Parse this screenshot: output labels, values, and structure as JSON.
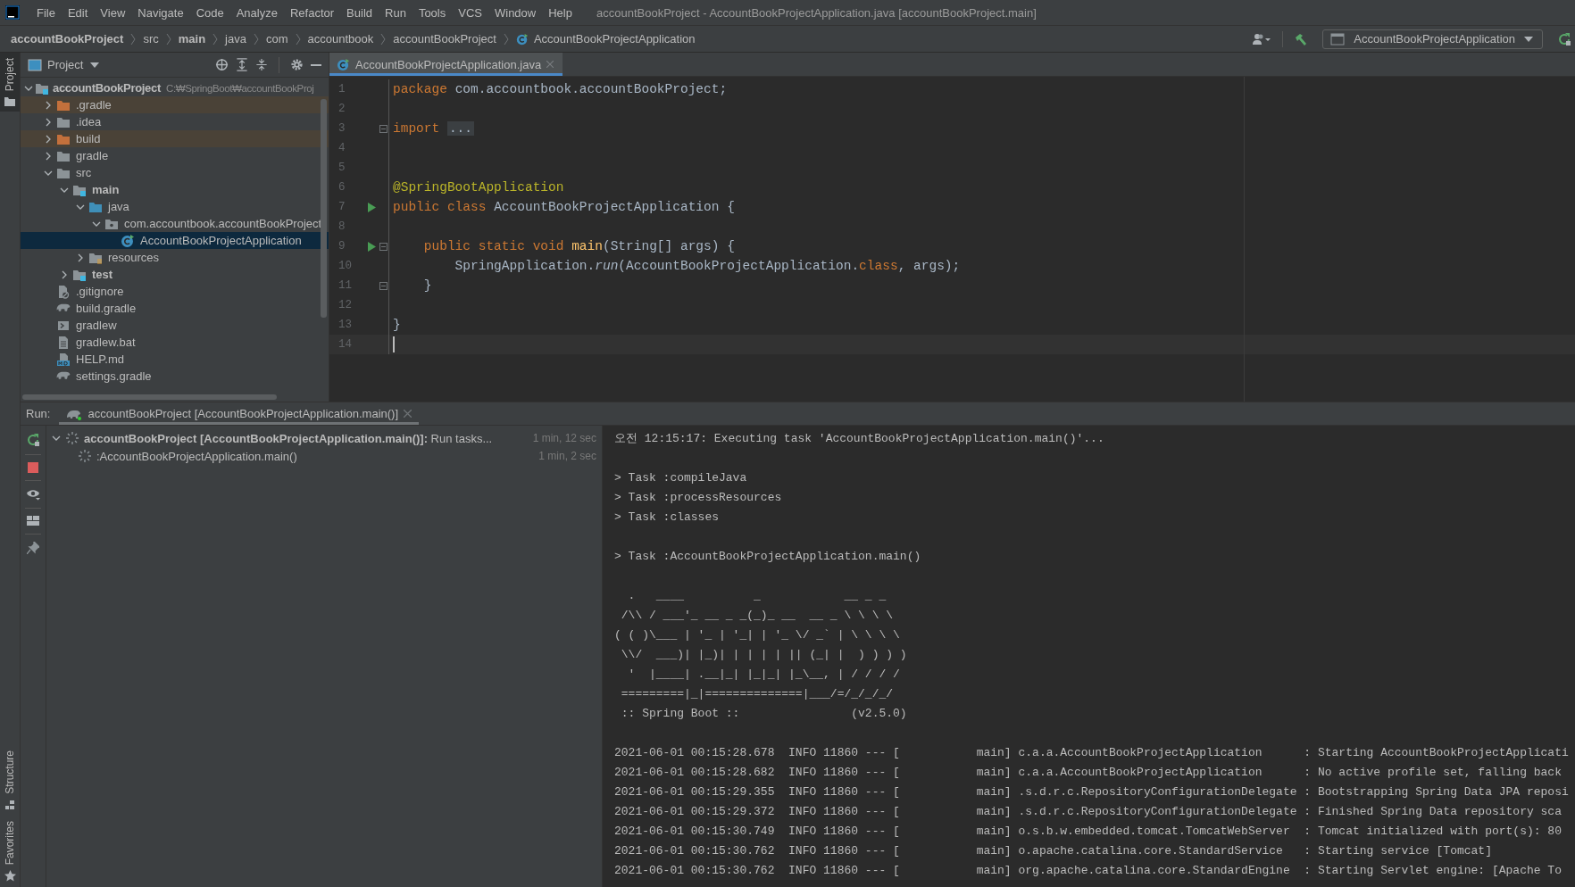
{
  "window": {
    "title": "accountBookProject - AccountBookProjectApplication.java [accountBookProject.main]"
  },
  "menu": [
    "File",
    "Edit",
    "View",
    "Navigate",
    "Code",
    "Analyze",
    "Refactor",
    "Build",
    "Run",
    "Tools",
    "VCS",
    "Window",
    "Help"
  ],
  "breadcrumbs": [
    {
      "label": "accountBookProject",
      "kind": "module"
    },
    {
      "label": "src",
      "kind": "folder"
    },
    {
      "label": "main",
      "kind": "module"
    },
    {
      "label": "java",
      "kind": "folder"
    },
    {
      "label": "com",
      "kind": "folder"
    },
    {
      "label": "accountbook",
      "kind": "folder"
    },
    {
      "label": "accountBookProject",
      "kind": "folder"
    },
    {
      "label": "AccountBookProjectApplication",
      "kind": "class"
    }
  ],
  "run_configuration": {
    "label": "AccountBookProjectApplication"
  },
  "tool_strip": {
    "top": [
      {
        "label": "Project",
        "selected": true
      }
    ],
    "bottom": [
      {
        "label": "Structure",
        "kind": "structure",
        "selected": false
      },
      {
        "label": "Favorites",
        "kind": "favorites",
        "selected": false
      }
    ]
  },
  "project_panel": {
    "title": "Project"
  },
  "project_tree": {
    "items": [
      {
        "label": "accountBookProject",
        "hint": "C:₩SpringBoot₩accountBookProj",
        "kind": "module",
        "expanded": true,
        "selected": false,
        "children": [
          {
            "label": ".gradle",
            "kind": "excluded-folder",
            "expanded": false,
            "selected": false
          },
          {
            "label": ".idea",
            "kind": "folder",
            "expanded": false,
            "selected": false
          },
          {
            "label": "build",
            "kind": "excluded-folder",
            "expanded": false,
            "selected": false
          },
          {
            "label": "gradle",
            "kind": "folder",
            "expanded": false,
            "selected": false
          },
          {
            "label": "src",
            "kind": "folder",
            "expanded": true,
            "selected": false,
            "children": [
              {
                "label": "main",
                "kind": "module",
                "expanded": true,
                "selected": false,
                "children": [
                  {
                    "label": "java",
                    "kind": "source-folder",
                    "expanded": true,
                    "selected": false,
                    "children": [
                      {
                        "label": "com.accountbook.accountBookProject",
                        "kind": "package",
                        "expanded": true,
                        "selected": false,
                        "children": [
                          {
                            "label": "AccountBookProjectApplication",
                            "kind": "class",
                            "selected": true
                          }
                        ]
                      }
                    ]
                  },
                  {
                    "label": "resources",
                    "kind": "resource-folder",
                    "expanded": false,
                    "selected": false
                  }
                ]
              },
              {
                "label": "test",
                "kind": "module",
                "expanded": false,
                "selected": false
              }
            ]
          },
          {
            "label": ".gitignore",
            "kind": "ignore-file",
            "selected": false
          },
          {
            "label": "build.gradle",
            "kind": "gradle-file",
            "selected": false
          },
          {
            "label": "gradlew",
            "kind": "script",
            "selected": false
          },
          {
            "label": "gradlew.bat",
            "kind": "text-file",
            "selected": false
          },
          {
            "label": "HELP.md",
            "kind": "markdown",
            "selected": false
          },
          {
            "label": "settings.gradle",
            "kind": "gradle-file",
            "selected": false
          }
        ]
      }
    ]
  },
  "editor_tabs": [
    {
      "label": "AccountBookProjectApplication.java",
      "selected": true
    }
  ],
  "code": [
    {
      "number": "1",
      "tokens": [
        {
          "text": "package ",
          "kind": "keyword"
        },
        {
          "text": "com.accountbook.accountBookProject;",
          "kind": "plain"
        }
      ]
    },
    {
      "number": "2"
    },
    {
      "number": "3",
      "fold_marker": true,
      "tokens": [
        {
          "text": "import ",
          "kind": "keyword"
        },
        {
          "text": "...",
          "kind": "folded"
        }
      ]
    },
    {
      "number": "4"
    },
    {
      "number": "5"
    },
    {
      "number": "6",
      "tokens": [
        {
          "text": "@SpringBootApplication",
          "kind": "annotation"
        }
      ]
    },
    {
      "number": "7",
      "run_marker": true,
      "tokens": [
        {
          "text": "public class ",
          "kind": "keyword"
        },
        {
          "text": "AccountBookProjectApplication {",
          "kind": "plain"
        }
      ]
    },
    {
      "number": "8"
    },
    {
      "number": "9",
      "run_marker": true,
      "fold_marker": true,
      "tokens": [
        {
          "text": "    public static void ",
          "kind": "keyword"
        },
        {
          "text": "main",
          "kind": "method"
        },
        {
          "text": "(String[] args) {",
          "kind": "plain"
        }
      ]
    },
    {
      "number": "10",
      "tokens": [
        {
          "text": "        SpringApplication.",
          "kind": "plain"
        },
        {
          "text": "run",
          "kind": "static-call"
        },
        {
          "text": "(AccountBookProjectApplication.",
          "kind": "plain"
        },
        {
          "text": "class",
          "kind": "keyword"
        },
        {
          "text": ", args);",
          "kind": "plain"
        }
      ]
    },
    {
      "number": "11",
      "fold_marker": true,
      "tokens": [
        {
          "text": "    }",
          "kind": "plain"
        }
      ]
    },
    {
      "number": "12"
    },
    {
      "number": "13",
      "tokens": [
        {
          "text": "}",
          "kind": "plain"
        }
      ]
    },
    {
      "number": "14",
      "current": true
    }
  ],
  "run_panel": {
    "label": "Run:",
    "tabs": [
      {
        "label": "accountBookProject [AccountBookProjectApplication.main()]",
        "selected": true
      }
    ],
    "tasks": [
      {
        "text": "**accountBookProject [AccountBookProjectApplication.main()]:** Run tasks...",
        "time": "1 min, 12 sec",
        "expanded": true,
        "children": [
          {
            "text": ":AccountBookProjectApplication.main()",
            "time": "1 min, 2 sec"
          }
        ]
      }
    ]
  },
  "console": {
    "blocks": [
      [
        "오전 12:15:17: Executing task 'AccountBookProjectApplication.main()'..."
      ],
      [
        "> Task :compileJava",
        "> Task :processResources",
        "> Task :classes"
      ],
      [
        "> Task :AccountBookProjectApplication.main()"
      ],
      [
        "  .   ____          _            __ _ _",
        " /\\\\ / ___'_ __ _ _(_)_ __  __ _ \\ \\ \\ \\",
        "( ( )\\___ | '_ | '_| | '_ \\/ _` | \\ \\ \\ \\",
        " \\\\/  ___)| |_)| | | | | || (_| |  ) ) ) )",
        "  '  |____| .__|_| |_|_| |_\\__, | / / / /",
        " =========|_|==============|___/=/_/_/_/",
        " :: Spring Boot ::                (v2.5.0)"
      ],
      [
        "2021-06-01 00:15:28.678  INFO 11860 --- [           main] c.a.a.AccountBookProjectApplication      : Starting AccountBookProjectApplicati",
        "2021-06-01 00:15:28.682  INFO 11860 --- [           main] c.a.a.AccountBookProjectApplication      : No active profile set, falling back",
        "2021-06-01 00:15:29.355  INFO 11860 --- [           main] .s.d.r.c.RepositoryConfigurationDelegate : Bootstrapping Spring Data JPA reposi",
        "2021-06-01 00:15:29.372  INFO 11860 --- [           main] .s.d.r.c.RepositoryConfigurationDelegate : Finished Spring Data repository sca",
        "2021-06-01 00:15:30.749  INFO 11860 --- [           main] o.s.b.w.embedded.tomcat.TomcatWebServer  : Tomcat initialized with port(s): 80",
        "2021-06-01 00:15:30.762  INFO 11860 --- [           main] o.apache.catalina.core.StandardService   : Starting service [Tomcat]",
        "2021-06-01 00:15:30.762  INFO 11860 --- [           main] org.apache.catalina.core.StandardEngine  : Starting Servlet engine: [Apache To"
      ]
    ]
  }
}
